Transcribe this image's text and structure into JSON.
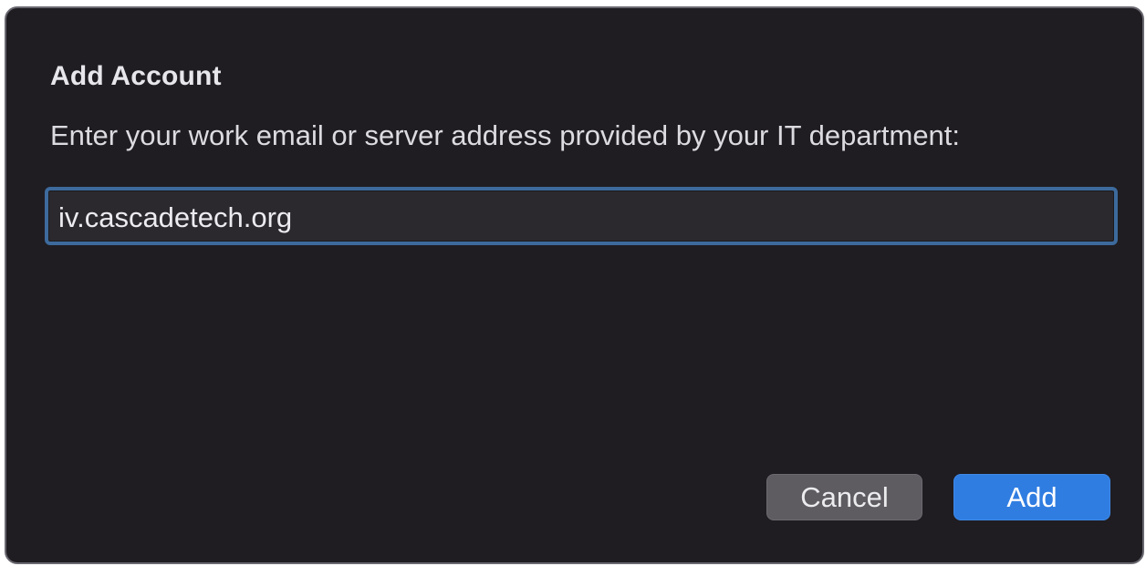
{
  "dialog": {
    "title": "Add Account",
    "prompt": "Enter your work email or server address provided by your IT department:",
    "input": {
      "value": "iv.cascadetech.org",
      "placeholder": ""
    },
    "buttons": {
      "cancel_label": "Cancel",
      "add_label": "Add"
    }
  },
  "colors": {
    "dialog_background": "#1f1d22",
    "focus_ring": "#3d6a9c",
    "primary_button": "#2f7de1",
    "secondary_button": "#5e5c61"
  }
}
